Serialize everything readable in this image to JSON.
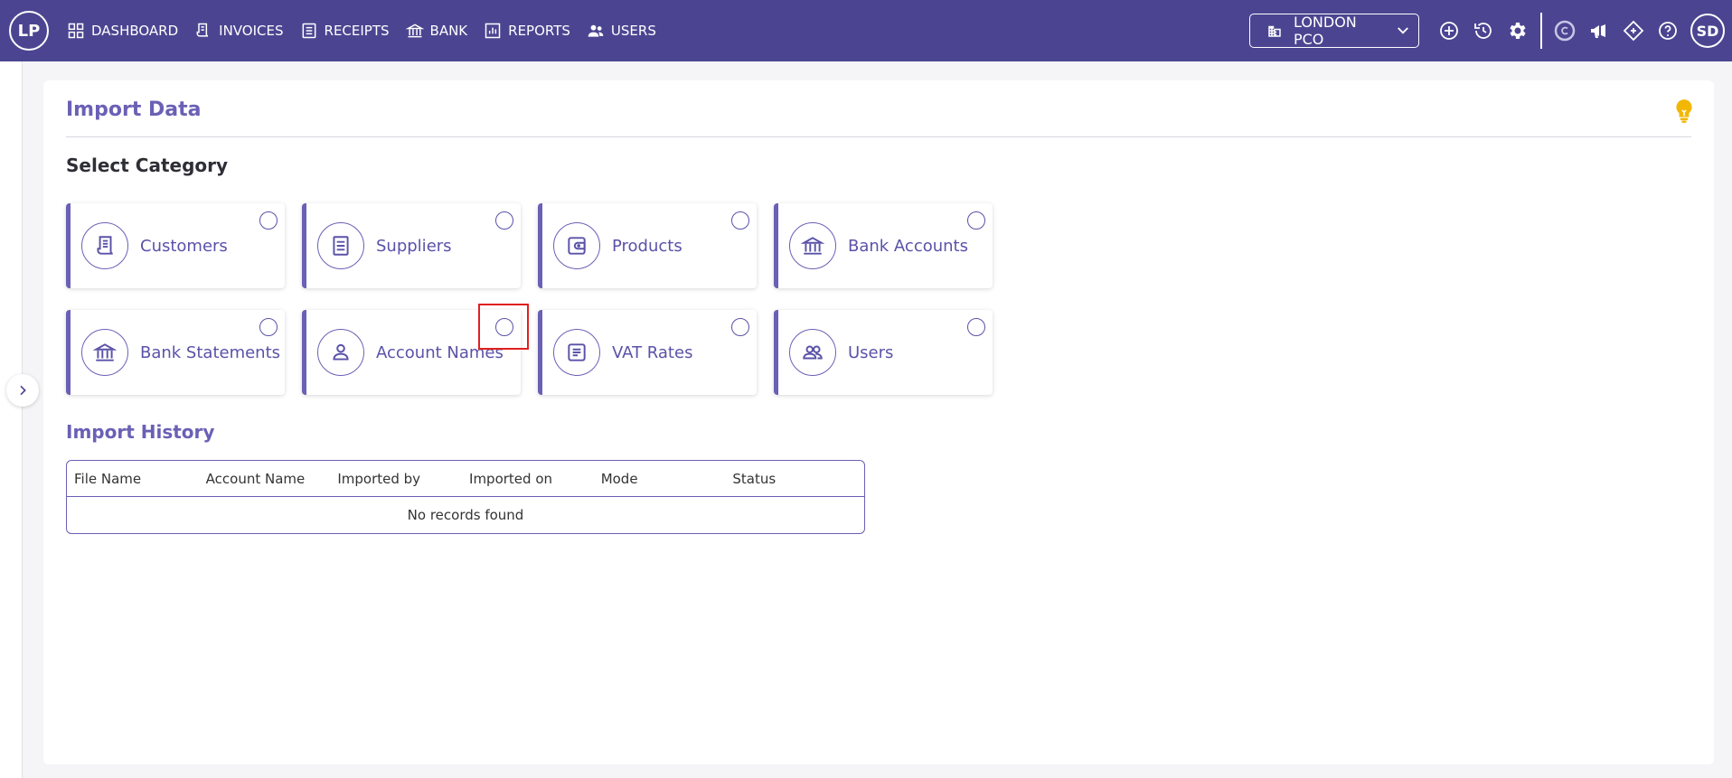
{
  "app": {
    "logo_text": "LP",
    "user_initials": "SD"
  },
  "nav": {
    "items": [
      {
        "label": "DASHBOARD",
        "icon": "dashboard-grid-icon"
      },
      {
        "label": "INVOICES",
        "icon": "invoice-icon"
      },
      {
        "label": "RECEIPTS",
        "icon": "receipt-icon"
      },
      {
        "label": "BANK",
        "icon": "bank-icon"
      },
      {
        "label": "REPORTS",
        "icon": "reports-chart-icon"
      },
      {
        "label": "USERS",
        "icon": "users-icon"
      }
    ]
  },
  "company": {
    "selected": "LONDON PCO"
  },
  "page": {
    "title": "Import Data",
    "select_category": "Select Category"
  },
  "categories": [
    {
      "label": "Customers",
      "icon": "customer-document-icon",
      "selected": false
    },
    {
      "label": "Suppliers",
      "icon": "supplier-list-icon",
      "selected": false
    },
    {
      "label": "Products",
      "icon": "product-wallet-icon",
      "selected": false
    },
    {
      "label": "Bank Accounts",
      "icon": "bank-icon",
      "selected": false
    },
    {
      "label": "Bank Statements",
      "icon": "bank-icon",
      "selected": false
    },
    {
      "label": "Account Names",
      "icon": "person-icon",
      "selected": false
    },
    {
      "label": "VAT Rates",
      "icon": "document-lines-icon",
      "selected": false
    },
    {
      "label": "Users",
      "icon": "users-icon",
      "selected": false
    }
  ],
  "history": {
    "title": "Import History",
    "columns": [
      "File Name",
      "Account Name",
      "Imported by",
      "Imported on",
      "Mode",
      "Status"
    ],
    "empty_message": "No records found"
  },
  "colors": {
    "primary": "#4b4591",
    "accent": "#6a60b5",
    "bulb": "#f2b705",
    "highlight": "#e02020"
  }
}
